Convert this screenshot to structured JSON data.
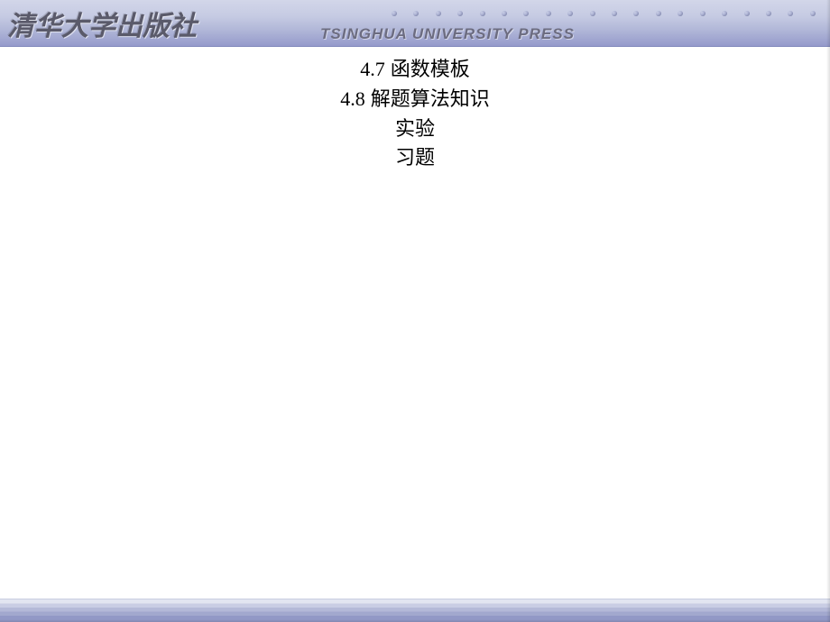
{
  "header": {
    "logo": "清华大学出版社",
    "subtitle": "TSINGHUA UNIVERSITY PRESS"
  },
  "toc": [
    {
      "num": "4.7",
      "title": "函数模板"
    },
    {
      "num": "4.8",
      "title": "解题算法知识"
    },
    {
      "num": "",
      "title": "实验"
    },
    {
      "num": "",
      "title": "习题"
    }
  ]
}
